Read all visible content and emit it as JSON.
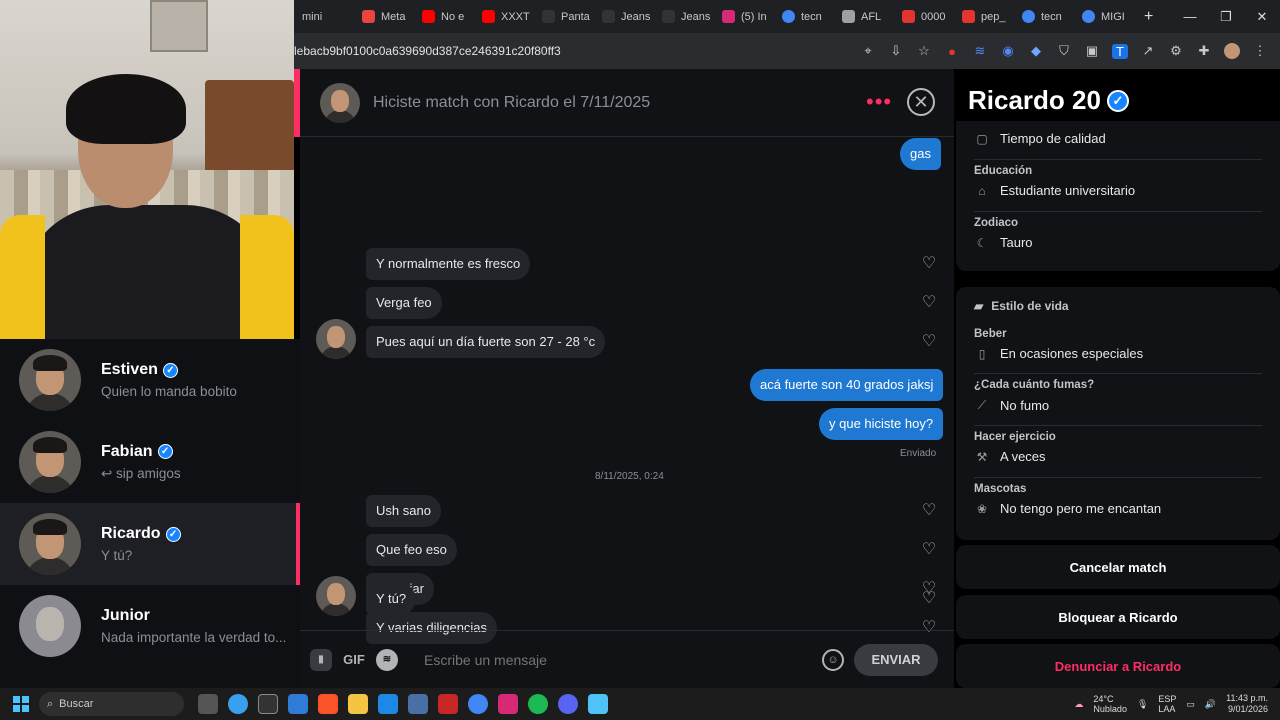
{
  "browser": {
    "tabs": [
      {
        "label": "mini",
        "color": "#5f6368"
      },
      {
        "label": "Meta",
        "color": "#e8453c"
      },
      {
        "label": "No e",
        "color": "#ff0000"
      },
      {
        "label": "XXXT",
        "color": "#ff0000"
      },
      {
        "label": "Panta",
        "color": "#222222"
      },
      {
        "label": "Jeans",
        "color": "#222222"
      },
      {
        "label": "Jeans",
        "color": "#222222"
      },
      {
        "label": "(5) In",
        "color": "#d62976"
      },
      {
        "label": "tecn",
        "color": "#4285f4"
      },
      {
        "label": "AFL",
        "color": "#a0a0a0"
      },
      {
        "label": "0000",
        "color": "#e3342f"
      },
      {
        "label": "pep_",
        "color": "#e3342f"
      },
      {
        "label": "tecn",
        "color": "#4285f4"
      },
      {
        "label": "MIGI",
        "color": "#4285f4"
      }
    ],
    "url": "lebacb9bf0100c0a639690d387ce246391c20f80ff3"
  },
  "matches": [
    {
      "name": "Estiven",
      "verified": true,
      "last_message": "Quien lo manda bobito"
    },
    {
      "name": "Fabian",
      "verified": true,
      "last_message": "↩ sip amigos"
    },
    {
      "name": "Ricardo",
      "verified": true,
      "last_message": "Y tú?"
    },
    {
      "name": "Junior",
      "verified": false,
      "last_message": "Nada importante la verdad to..."
    }
  ],
  "chat": {
    "header_title": "Hiciste match con Ricardo el 7/11/2025",
    "sent_label": "Enviado",
    "date_separator": "8/11/2025, 0:24",
    "messages": [
      {
        "text": "gas",
        "dir": "out"
      },
      {
        "text": "Y normalmente es fresco",
        "dir": "in"
      },
      {
        "text": "Verga feo",
        "dir": "in"
      },
      {
        "text": "Pues aquí un día fuerte son 27 - 28 °c",
        "dir": "in"
      },
      {
        "text": "acá fuerte son 40 grados jaksj",
        "dir": "out"
      },
      {
        "text": "y que hiciste hoy?",
        "dir": "out"
      },
      {
        "text": "Ush sano",
        "dir": "in"
      },
      {
        "text": "Que feo eso",
        "dir": "in"
      },
      {
        "text": "Trabajar",
        "dir": "in"
      },
      {
        "text": "Y varias diligencias",
        "dir": "in"
      },
      {
        "text": "Y tú?",
        "dir": "in"
      }
    ],
    "composer": {
      "gif_label": "GIF",
      "placeholder": "Escribe un mensaje",
      "send_label": "ENVIAR"
    }
  },
  "profile": {
    "name_age": "Ricardo 20",
    "love_language": "Tiempo de calidad",
    "education_label": "Educación",
    "education": "Estudiante universitario",
    "zodiac_label": "Zodiaco",
    "zodiac": "Tauro",
    "lifestyle_title": "Estilo de vida",
    "drink_label": "Beber",
    "drink": "En ocasiones especiales",
    "smoke_label": "¿Cada cuánto fumas?",
    "smoke": "No fumo",
    "exercise_label": "Hacer ejercicio",
    "exercise": "A veces",
    "pets_label": "Mascotas",
    "pets": "No tengo pero me encantan",
    "actions": {
      "cancel": "Cancelar match",
      "block": "Bloquear a Ricardo",
      "report": "Denunciar a Ricardo"
    }
  },
  "taskbar": {
    "search_label": "Buscar",
    "temperature": "24°C",
    "weather": "Nublado",
    "lang_top": "ESP",
    "lang_bottom": "LAA",
    "time": "11:43 p.m.",
    "date": "9/01/2026"
  }
}
